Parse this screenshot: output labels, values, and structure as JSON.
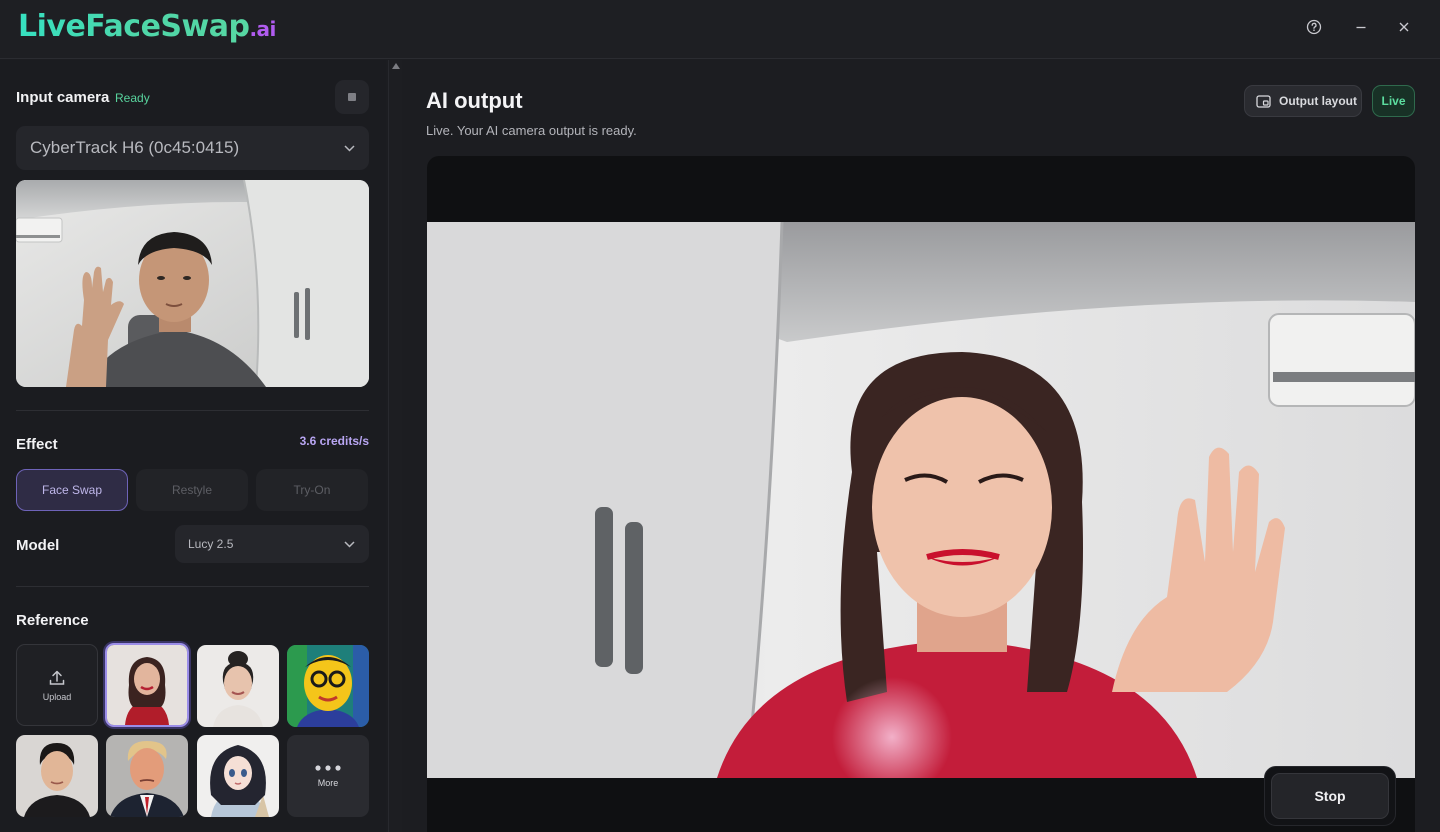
{
  "app": {
    "logo_main": "LiveFaceSwap",
    "logo_suffix": ".ai"
  },
  "window_controls": {
    "help_icon": "help-circle-icon",
    "minimize_icon": "minimize-icon",
    "close_icon": "close-icon"
  },
  "input_camera": {
    "title": "Input camera",
    "status": "Ready",
    "device": "CyberTrack H6 (0c45:0415)"
  },
  "effect": {
    "title": "Effect",
    "credits": "3.6 credits/s",
    "options": [
      "Face Swap",
      "Restyle",
      "Try-On"
    ],
    "selected": "Face Swap"
  },
  "model": {
    "title": "Model",
    "value": "Lucy 2.5"
  },
  "reference": {
    "title": "Reference",
    "upload_label": "Upload",
    "more_label": "More"
  },
  "output": {
    "title": "AI output",
    "subtitle": "Live. Your AI camera output is ready.",
    "layout_button": "Output layout",
    "live_badge": "Live",
    "stop_button": "Stop"
  },
  "colors": {
    "accent_green": "#58d39d",
    "accent_purple": "#9b8de8",
    "logo_teal": "#36e0c0",
    "logo_ai": "#b15cf0"
  }
}
